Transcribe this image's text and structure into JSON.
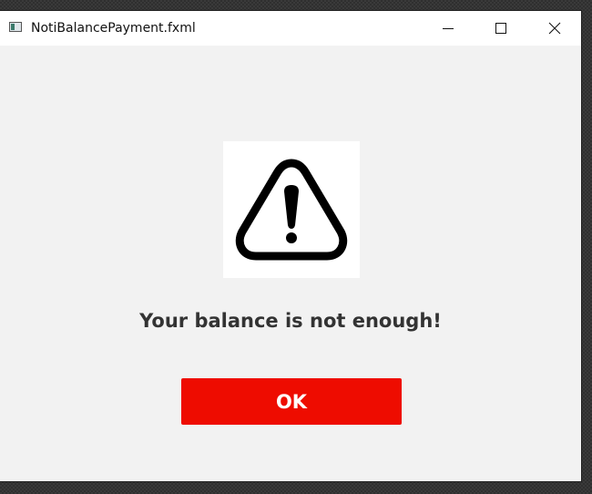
{
  "window": {
    "title": "NotiBalancePayment.fxml",
    "controls": {
      "minimize_icon": "minimize-icon",
      "maximize_icon": "maximize-icon",
      "close_icon": "close-icon"
    }
  },
  "dialog": {
    "icon": "warning-triangle-icon",
    "message": "Your balance is not enough!",
    "ok_label": "OK"
  },
  "colors": {
    "button_bg": "#ee0c00",
    "button_text": "#ffffff",
    "message_text": "#333333",
    "content_bg": "#f2f2f2"
  }
}
